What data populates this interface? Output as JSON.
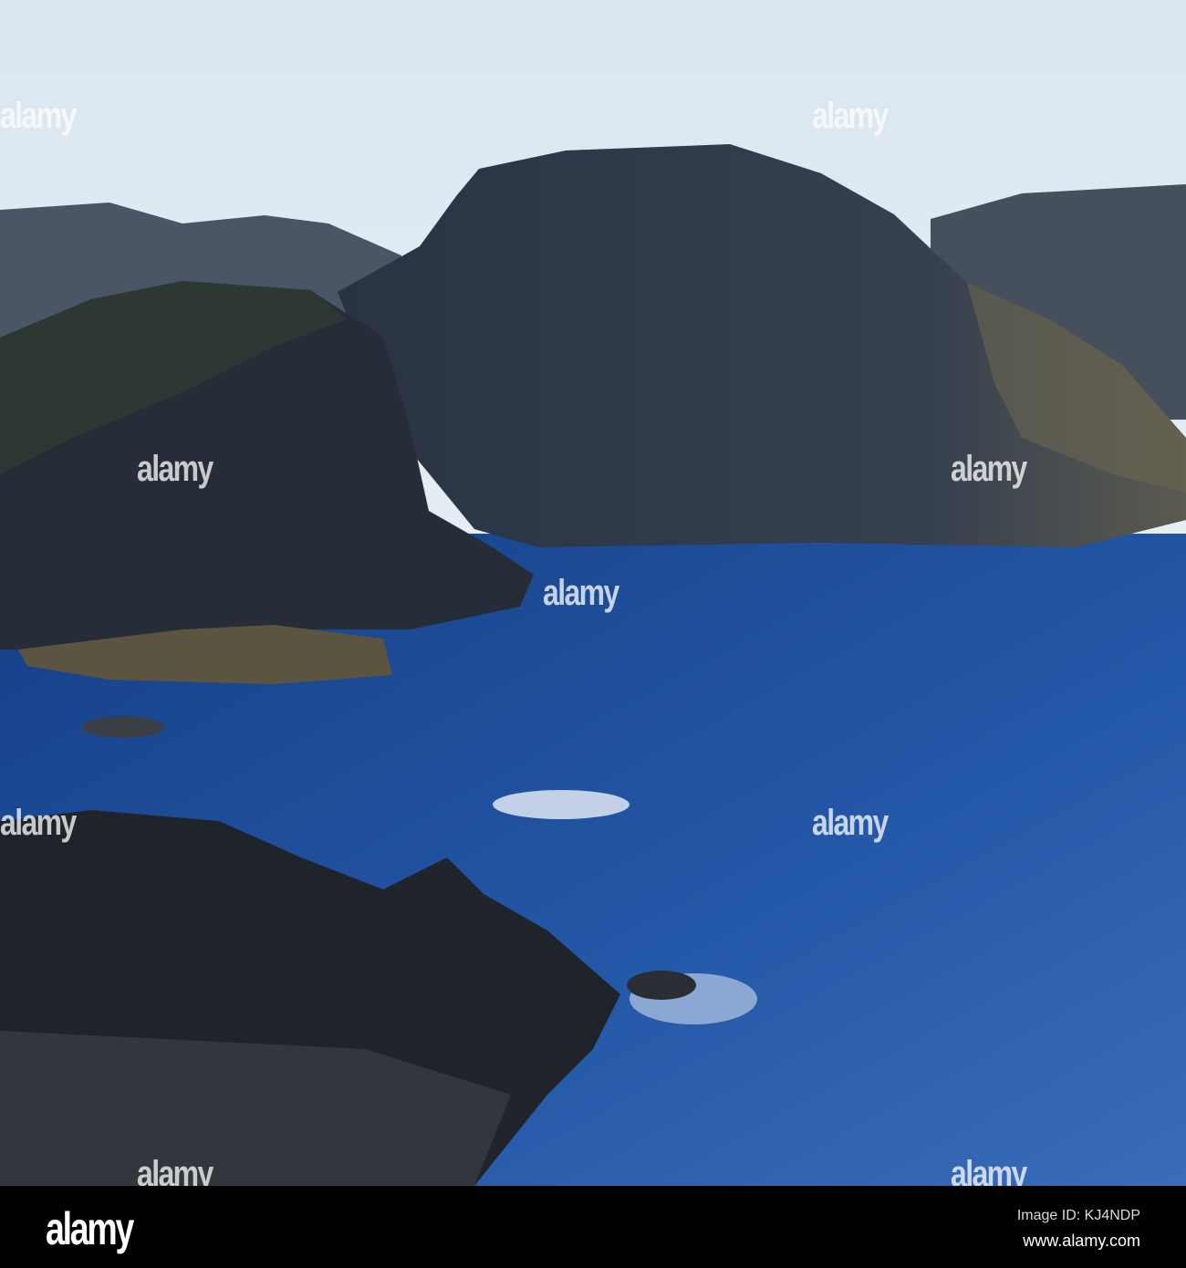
{
  "watermark": {
    "text": "alamy"
  },
  "footer": {
    "logo": "alamy",
    "image_id": "Image ID: KJ4NDP",
    "website": "www.alamy.com"
  },
  "colors": {
    "sky": "#dfe9f2",
    "water": "#1c4d9a",
    "rock": "#2a2f3a"
  }
}
